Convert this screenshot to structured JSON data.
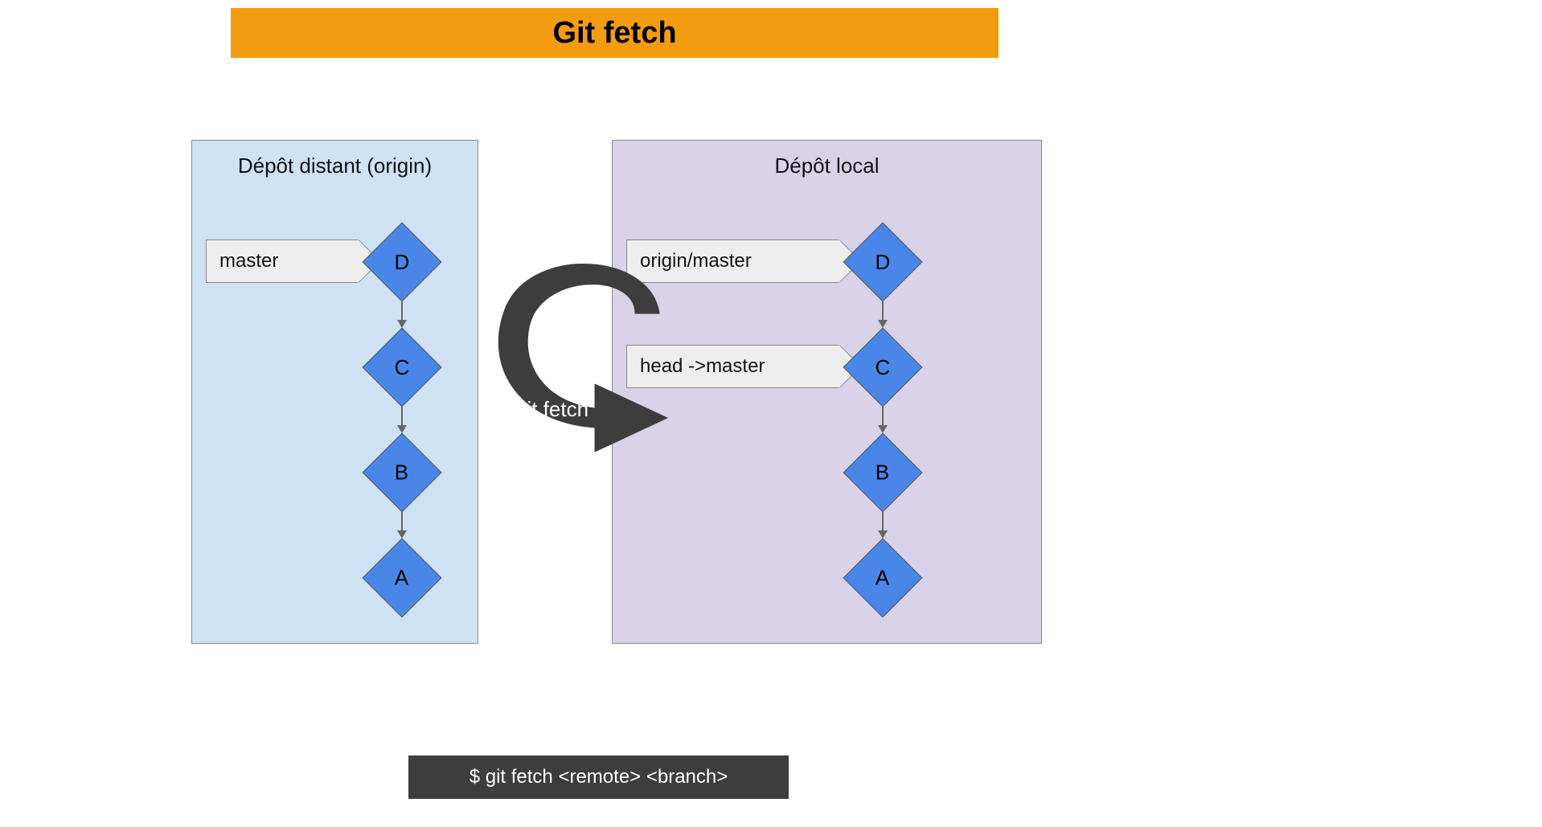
{
  "title": "Git fetch",
  "remote_repo": {
    "title": "Dépôt distant (origin)",
    "pointer_master": "master",
    "commits": {
      "d": "D",
      "c": "C",
      "b": "B",
      "a": "A"
    }
  },
  "local_repo": {
    "title": "Dépôt local",
    "pointer_origin_master": "origin/master",
    "pointer_head_master": "head ->master",
    "commits": {
      "d": "D",
      "c": "C",
      "b": "B",
      "a": "A"
    }
  },
  "arrow_label": "git fetch",
  "command": "$ git fetch <remote> <branch>"
}
